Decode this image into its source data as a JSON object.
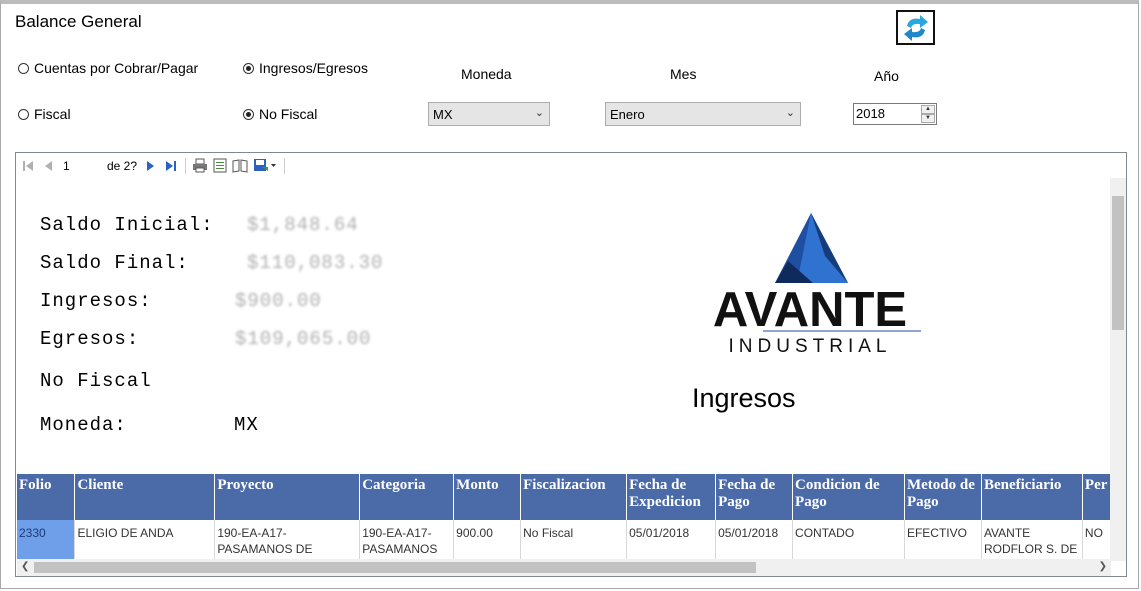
{
  "window": {
    "title": "Balance General"
  },
  "options": {
    "cuentas": "Cuentas por Cobrar/Pagar",
    "ingresos_egresos": "Ingresos/Egresos",
    "fiscal": "Fiscal",
    "no_fiscal": "No Fiscal"
  },
  "filters": {
    "moneda_label": "Moneda",
    "mes_label": "Mes",
    "anio_label": "Año",
    "moneda_value": "MX",
    "mes_value": "Enero",
    "anio_value": "2018"
  },
  "toolbar": {
    "page": "1",
    "of_label": "de 2?"
  },
  "report": {
    "saldo_inicial_label": "Saldo Inicial:",
    "saldo_inicial_value": "$1,848.64",
    "saldo_final_label": "Saldo Final:",
    "saldo_final_value": "$110,083.30",
    "ingresos_label": "Ingresos:",
    "ingresos_value": "$900.00",
    "egresos_label": "Egresos:",
    "egresos_value": "$109,065.00",
    "fiscal_mode": "No Fiscal",
    "moneda_label": "Moneda:",
    "moneda_value": "MX",
    "section_title": "Ingresos",
    "logo_main": "AVANTE",
    "logo_sub": "INDUSTRIAL"
  },
  "table": {
    "headers": [
      "Folio",
      "Cliente",
      "Proyecto",
      "Categoria",
      "Monto",
      "Fiscalizacion",
      "Fecha de Expedicion",
      "Fecha de Pago",
      "Condicion de Pago",
      "Metodo de Pago",
      "Beneficiario",
      "Per"
    ],
    "rows": [
      [
        "2330",
        "ELIGIO DE ANDA",
        "190-EA-A17-PASAMANOS DE",
        "190-EA-A17-PASAMANOS",
        "900.00",
        "No Fiscal",
        "05/01/2018",
        "05/01/2018",
        "CONTADO",
        "EFECTIVO",
        "AVANTE RODFLOR S. DE",
        "NO"
      ]
    ]
  },
  "colors": {
    "header_bg": "#4a6aa8",
    "selected_cell": "#6f9fe8",
    "logo_blue": "#1f4fa0"
  }
}
